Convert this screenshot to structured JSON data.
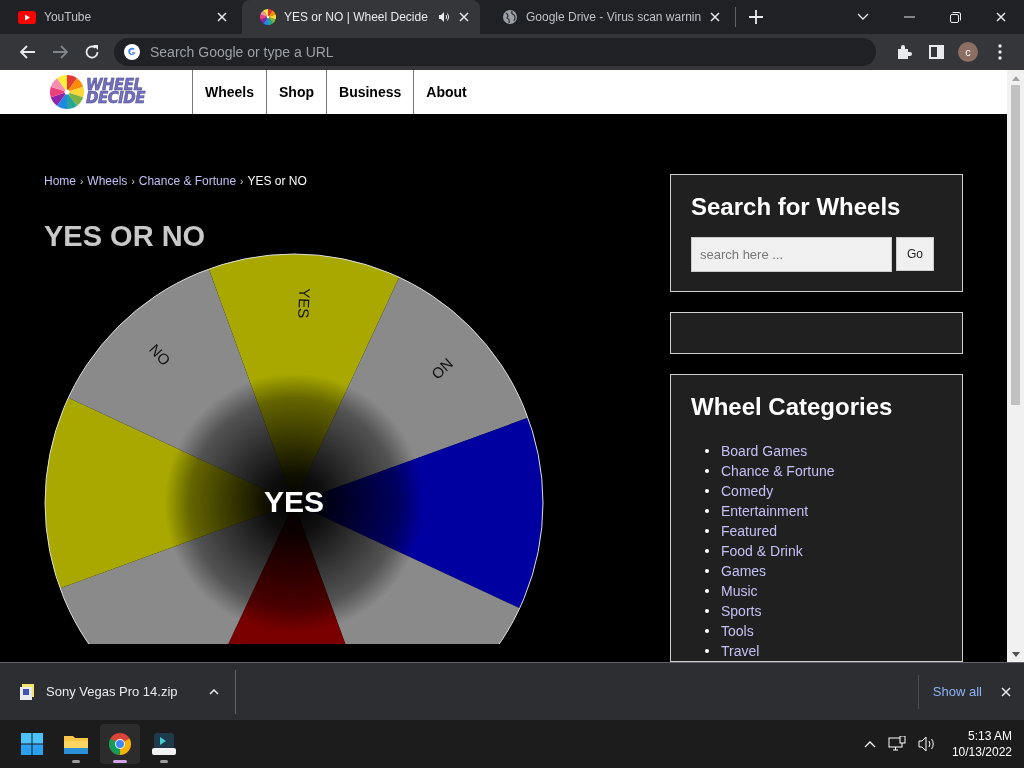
{
  "browser": {
    "tabs": [
      {
        "title": "YouTube",
        "selected": false,
        "kind": "youtube",
        "audio": false
      },
      {
        "title": "YES or NO | Wheel Decide",
        "selected": true,
        "kind": "wheel",
        "audio": true
      },
      {
        "title": "Google Drive - Virus scan warnin",
        "selected": false,
        "kind": "globe",
        "audio": false
      }
    ],
    "address_placeholder": "Search Google or type a URL",
    "profile_initial": "c"
  },
  "site": {
    "logo": [
      "WHEEL",
      "DECIDE"
    ],
    "nav": [
      "Wheels",
      "Shop",
      "Business",
      "About"
    ],
    "breadcrumb": [
      {
        "label": "Home",
        "link": true
      },
      {
        "separator": "›",
        "label": "Wheels",
        "link": true
      },
      {
        "separator": "›",
        "label": "Chance & Fortune",
        "link": true
      },
      {
        "separator": "›",
        "label": "YES or NO",
        "link": false
      }
    ],
    "title": "YES OR NO",
    "wheel": {
      "result": "YES",
      "segments": [
        {
          "label": "YES",
          "color": "#a8a800"
        },
        {
          "label": "NO",
          "color": "#8a8a8a"
        },
        {
          "color": "#0000a0"
        },
        {
          "color": "#8a8a8a"
        },
        {
          "color": "#7a0000"
        },
        {
          "color": "#8a8a8a"
        },
        {
          "color": "#a8a800"
        },
        {
          "label": "NO",
          "color": "#8a8a8a"
        }
      ]
    }
  },
  "sidebar": {
    "search_title": "Search for Wheels",
    "search_placeholder": "search here ...",
    "search_button": "Go",
    "categories_title": "Wheel Categories",
    "categories": [
      "Board Games",
      "Chance & Fortune",
      "Comedy",
      "Entertainment",
      "Featured",
      "Food & Drink",
      "Games",
      "Music",
      "Sports",
      "Tools",
      "Travel"
    ]
  },
  "downloads": {
    "file": "Sony Vegas Pro 14.zip",
    "show_all": "Show all"
  },
  "taskbar": {
    "time": "5:13 AM",
    "date": "10/13/2022"
  }
}
